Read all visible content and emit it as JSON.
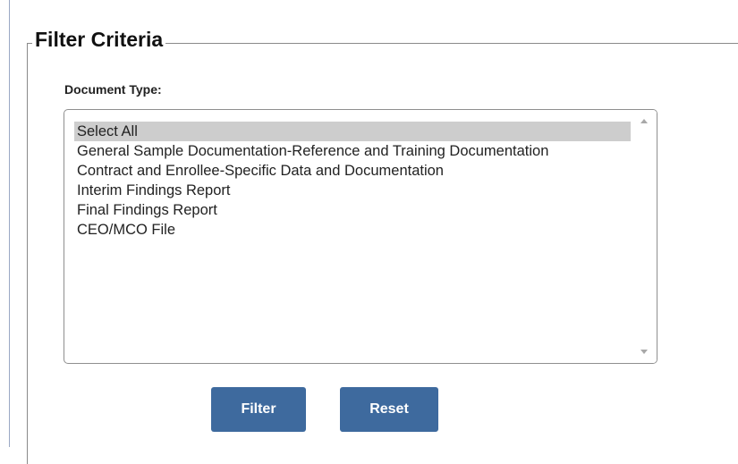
{
  "filter_panel": {
    "legend": "Filter Criteria",
    "document_type_label": "Document Type:",
    "document_types": [
      {
        "label": "Select All",
        "selected": true
      },
      {
        "label": "General Sample Documentation-Reference and Training Documentation",
        "selected": false
      },
      {
        "label": "Contract and Enrollee-Specific Data and Documentation",
        "selected": false
      },
      {
        "label": "Interim Findings Report",
        "selected": false
      },
      {
        "label": "Final Findings Report",
        "selected": false
      },
      {
        "label": "CEO/MCO File",
        "selected": false
      }
    ],
    "filter_button_label": "Filter",
    "reset_button_label": "Reset"
  },
  "colors": {
    "button_background": "#3e6a9e",
    "button_text": "#ffffff",
    "selected_option_background": "#cdcdcd"
  },
  "icons": {
    "scroll_up": "scroll-up-arrow-icon",
    "scroll_down": "scroll-down-arrow-icon"
  }
}
